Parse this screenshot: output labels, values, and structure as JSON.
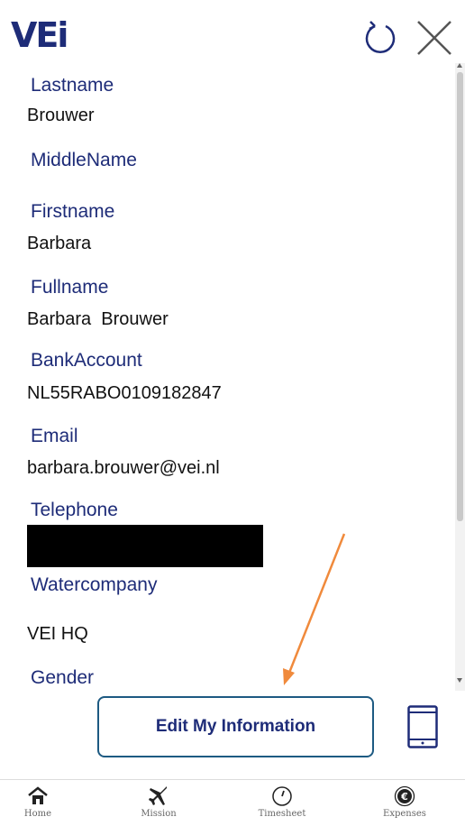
{
  "header": {
    "logo_text": "VEi",
    "refresh_icon": "refresh-icon",
    "close_icon": "close-icon"
  },
  "profile": {
    "lastname_label": "Lastname",
    "lastname_value": "Brouwer",
    "middlename_label": "MiddleName",
    "middlename_value": "",
    "firstname_label": "Firstname",
    "firstname_value": "Barbara",
    "fullname_label": "Fullname",
    "fullname_value": "Barbara  Brouwer",
    "bankaccount_label": "BankAccount",
    "bankaccount_value": "NL55RABO0109182847",
    "email_label": "Email",
    "email_value": "barbara.brouwer@vei.nl",
    "telephone_label": "Telephone",
    "watercompany_label": "Watercompany",
    "watercompany_value": "VEI HQ",
    "gender_label": "Gender"
  },
  "actions": {
    "edit_label": "Edit My Information",
    "phone_icon": "mobile-phone-icon"
  },
  "nav": {
    "items": [
      {
        "label": "Home",
        "icon": "home-icon"
      },
      {
        "label": "Mission",
        "icon": "airplane-icon"
      },
      {
        "label": "Timesheet",
        "icon": "clock-icon"
      },
      {
        "label": "Expenses",
        "icon": "euro-icon"
      }
    ]
  },
  "colors": {
    "brand": "#1e2c78",
    "button_border": "#1d5a82",
    "annotation_arrow": "#f08a3c"
  }
}
